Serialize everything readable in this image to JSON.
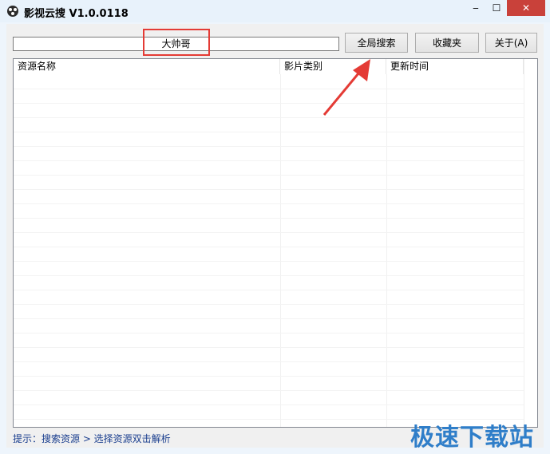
{
  "window": {
    "title": "影视云搜 V1.0.0118",
    "minimize_glyph": "‒",
    "maximize_glyph": "☐",
    "close_glyph": "✕"
  },
  "search": {
    "value": "大帅哥",
    "search_button": "全局搜索",
    "favorites_button": "收藏夹",
    "about_button": "关于(A)"
  },
  "table": {
    "columns": [
      "资源名称",
      "影片类别",
      "更新时间"
    ],
    "rows": []
  },
  "status": {
    "text": "提示：搜索资源 > 选择资源双击解析"
  },
  "watermark": {
    "text": "极速下载站"
  },
  "colors": {
    "highlight": "#e43b35",
    "arrow": "#e43b35",
    "watermark": "#2f7ec9"
  }
}
